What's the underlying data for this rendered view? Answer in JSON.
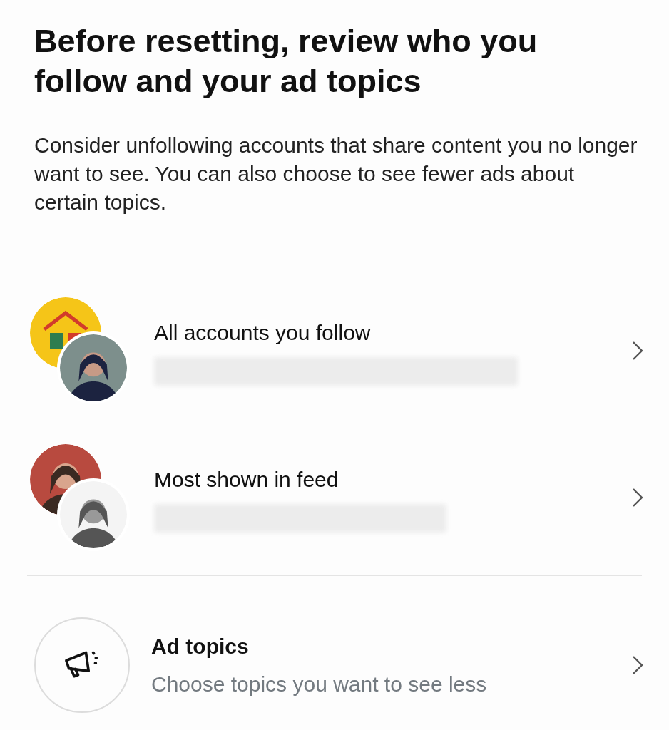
{
  "title": "Before resetting, review who you follow and your ad topics",
  "description": "Consider unfollowing accounts that share content you no longer want to see. You can also choose to see fewer ads about certain topics.",
  "rows": [
    {
      "kind": "accounts",
      "title": "All accounts you follow"
    },
    {
      "kind": "accounts",
      "title": "Most shown in feed"
    },
    {
      "kind": "topic",
      "title": "Ad topics",
      "subtitle": "Choose topics you want to see less"
    }
  ]
}
